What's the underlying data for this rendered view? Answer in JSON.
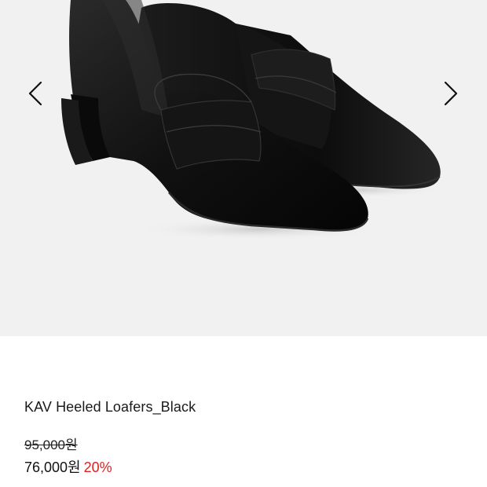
{
  "gallery": {
    "prev_icon": "chevron-left-icon",
    "next_icon": "chevron-right-icon",
    "background_color": "#f1f1f1"
  },
  "product": {
    "name": "KAV Heeled Loafers_Black",
    "original_price": "95,000원",
    "sale_price": "76,000원",
    "discount": "20%",
    "discount_color": "#e02020"
  }
}
